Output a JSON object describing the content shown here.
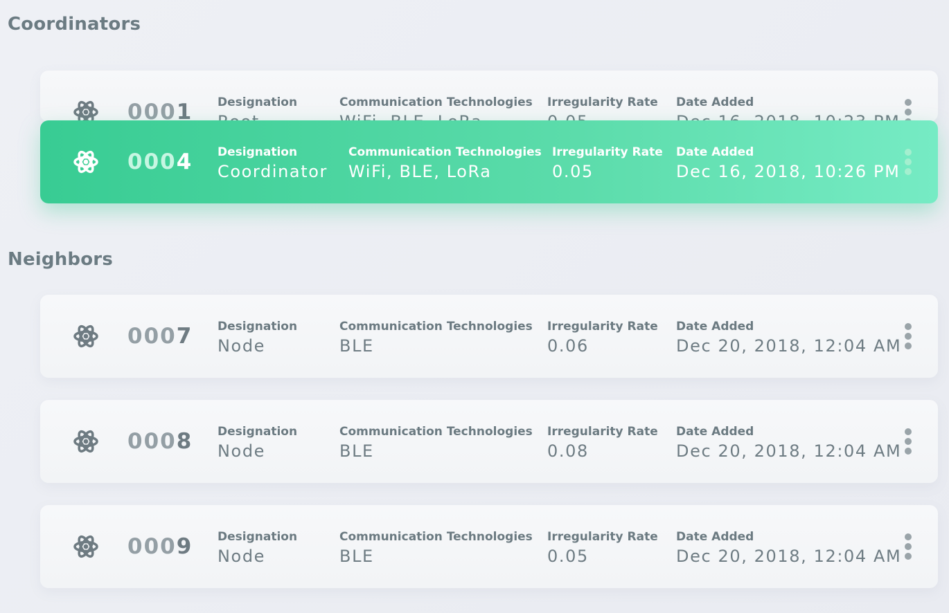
{
  "sections": {
    "coordinators": {
      "title": "Coordinators"
    },
    "neighbors": {
      "title": "Neighbors"
    }
  },
  "labels": {
    "designation": "Designation",
    "communication": "Communication Technologies",
    "irregularity": "Irregularity Rate",
    "date_added": "Date Added"
  },
  "icons": {
    "node": "atom-icon",
    "menu": "more-vertical-icon"
  },
  "colors": {
    "accent": "#38cc93",
    "accent_light": "#76ebc4",
    "text": "#6e7c83",
    "heading": "#6b7b82"
  },
  "coordinators": [
    {
      "id_prefix": "000",
      "id_last": "1",
      "designation": "Root",
      "communication": "WiFi, BLE, LoRa",
      "irregularity": "0.05",
      "date_added": "Dec 16, 2018, 10:23 PM",
      "state": "partially covered"
    },
    {
      "id_prefix": "000",
      "id_last": "4",
      "designation": "Coordinator",
      "communication": "WiFi, BLE, LoRa",
      "irregularity": "0.05",
      "date_added": "Dec 16, 2018, 10:26 PM",
      "state": "selected"
    }
  ],
  "neighbors": [
    {
      "id_prefix": "000",
      "id_last": "7",
      "designation": "Node",
      "communication": "BLE",
      "irregularity": "0.06",
      "date_added": "Dec 20, 2018, 12:04 AM"
    },
    {
      "id_prefix": "000",
      "id_last": "8",
      "designation": "Node",
      "communication": "BLE",
      "irregularity": "0.08",
      "date_added": "Dec 20, 2018, 12:04 AM"
    },
    {
      "id_prefix": "000",
      "id_last": "9",
      "designation": "Node",
      "communication": "BLE",
      "irregularity": "0.05",
      "date_added": "Dec 20, 2018, 12:04 AM"
    }
  ]
}
